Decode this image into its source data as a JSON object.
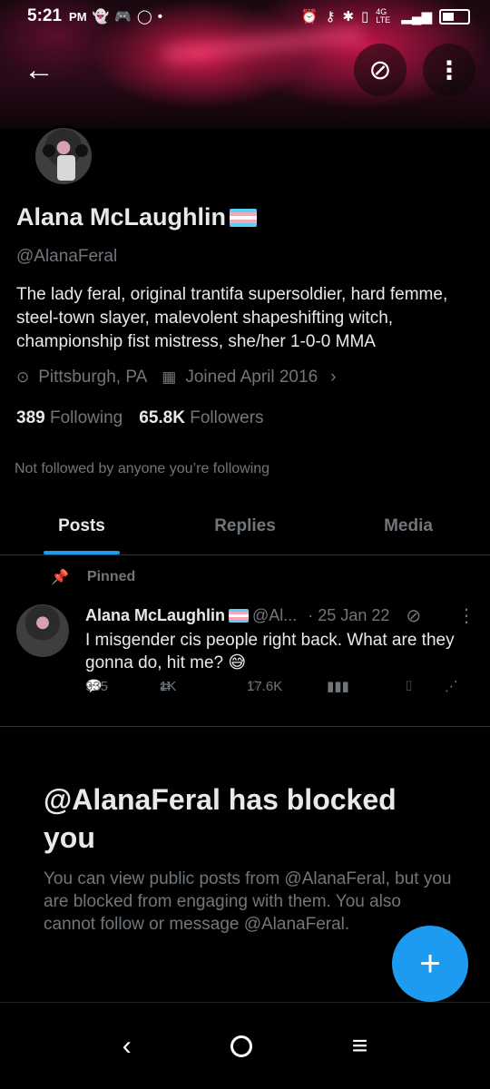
{
  "status_bar": {
    "time": "5:21",
    "ampm": "PM",
    "network": "4G LTE"
  },
  "profile": {
    "name": "Alana McLaughlin",
    "handle": "@AlanaFeral",
    "bio": "The lady feral, original trantifa supersoldier, hard femme, steel-town slayer, malevolent shapeshifting witch, championship fist mistress, she/her  1-0-0 MMA",
    "location": "Pittsburgh, PA",
    "joined": "Joined April 2016",
    "following_count": "389",
    "following_label": "Following",
    "followers_count": "65.8K",
    "followers_label": "Followers",
    "not_followed": "Not followed by anyone you’re following"
  },
  "tabs": [
    {
      "label": "Posts",
      "active": true
    },
    {
      "label": "Replies",
      "active": false
    },
    {
      "label": "Media",
      "active": false
    }
  ],
  "pinned_post": {
    "pinned_label": "Pinned",
    "author": "Alana McLaughlin",
    "handle": "@Al...",
    "date": "· 25 Jan 22",
    "text": "I misgender cis people right back. What are they gonna do, hit me? 😅",
    "replies": "935",
    "reposts": "1K",
    "likes": "17.6K"
  },
  "blocked": {
    "title": "@AlanaFeral has blocked you",
    "description": "You can view public posts from @AlanaFeral, but you are blocked from engaging with them. You also cannot follow or message @AlanaFeral."
  },
  "icons": {
    "back": "back-arrow-icon",
    "grok": "grok-icon",
    "more": "more-vertical-icon",
    "compose": "compose-plus-icon"
  },
  "colors": {
    "accent": "#1d9bf0",
    "text": "#e7e9ea",
    "muted": "#71767b",
    "background": "#000000"
  }
}
